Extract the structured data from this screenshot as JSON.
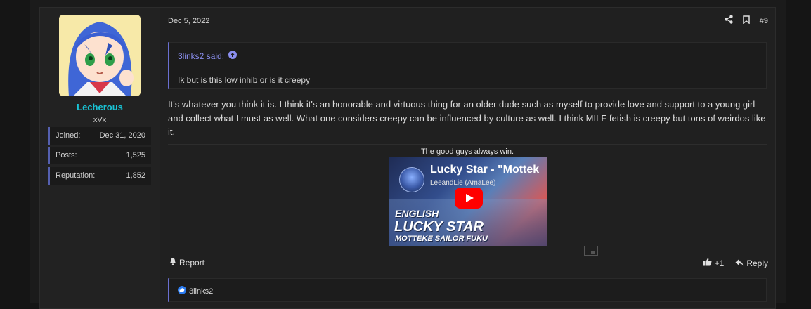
{
  "user": {
    "name": "Lecherous",
    "title": "xVx",
    "stats": [
      {
        "label": "Joined:",
        "value": "Dec 31, 2020"
      },
      {
        "label": "Posts:",
        "value": "1,525"
      },
      {
        "label": "Reputation:",
        "value": "1,852"
      }
    ]
  },
  "post": {
    "date": "Dec 5, 2022",
    "number": "#9",
    "quote": {
      "author": "3links2 said:",
      "text": "Ik but is this low inhib or is it creepy"
    },
    "body": "It's whatever you think it is. I think it's an honorable and virtuous thing for an older dude such as myself to provide love and support to a young girl and collect what I must as well. What one considers creepy can be influenced by culture as well. I think MILF fetish is creepy but tons of weirdos like it.",
    "signature": {
      "caption": "The good guys always win.",
      "video": {
        "title": "Lucky Star - \"Mottek",
        "channel": "LeeandLie (AmaLee)",
        "thumb_line1": "ENGLISH",
        "thumb_line2": "LUCKY STAR",
        "thumb_line3": "MOTTEKE SAILOR FUKU"
      }
    },
    "actions": {
      "report": "Report",
      "like_count": "+1",
      "reply": "Reply"
    },
    "reactions": {
      "users": "3links2"
    }
  },
  "icons": [
    "share-icon",
    "bookmark-icon",
    "quote-arrow-up-icon",
    "bell-icon",
    "thumbs-up-icon",
    "reply-icon",
    "youtube-play-icon",
    "embed-icon",
    "like-reaction-icon"
  ],
  "colors": {
    "username": "#19c4d6",
    "quote_accent": "#6a6fd0",
    "link": "#8b8ff0",
    "youtube_red": "#ff0000"
  }
}
